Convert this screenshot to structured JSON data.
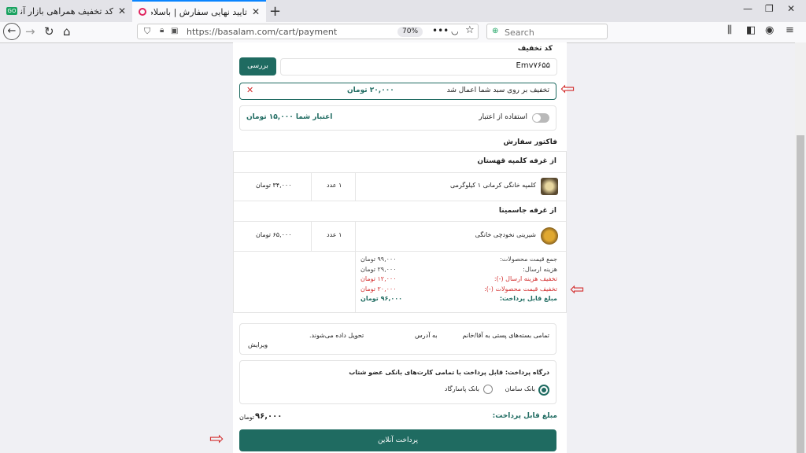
{
  "browser": {
    "tabs": [
      {
        "title": "کد تخفیف همراهی بازار آنلاین مح..."
      },
      {
        "title": "تایید نهایی سفارش | باسلام"
      }
    ],
    "url": "https://basalam.com/cart/payment",
    "zoom": "70%",
    "search_placeholder": "Search"
  },
  "discount": {
    "label": "کد تخفیف",
    "code": "Emv۷۶۵۵",
    "check_button": "بررسی",
    "applied_text": "تخفیف بر روی سبد شما اعمال شد",
    "applied_amount": "۲۰,۰۰۰ تومان"
  },
  "credit": {
    "label": "استفاده از اعتبار",
    "balance": "اعتبار شما ۱۵,۰۰۰ تومان"
  },
  "invoice": {
    "title": "فاکتور سفارش",
    "booths": [
      {
        "title": "از غرفه کلمپه قهستان",
        "product": "کلمپه خانگی کرمانی ۱ کیلوگرمی",
        "qty": "۱ عدد",
        "price": "۳۴,۰۰۰ تومان"
      },
      {
        "title": "از غرفه جاسمینا",
        "product": "شیرینی نخودچی خانگی",
        "qty": "۱ عدد",
        "price": "۶۵,۰۰۰ تومان"
      }
    ],
    "summary": [
      {
        "label": "جمع قیمت محصولات:",
        "value": "۹۹,۰۰۰ تومان",
        "color": "#444444"
      },
      {
        "label": "هزینه ارسال:",
        "value": "۲۹,۰۰۰ تومان",
        "color": "#444444"
      },
      {
        "label": "تخفیف هزینه ارسال (-):",
        "value": "۱۲,۰۰۰ تومان",
        "color": "#d32f2f"
      },
      {
        "label": "تخفیف قیمت محصولات (-):",
        "value": "۲۰,۰۰۰ تومان",
        "color": "#d32f2f"
      },
      {
        "label": "مبلغ قابل پرداخت:",
        "value": "۹۶,۰۰۰ تومان",
        "color": "#1f6b61"
      }
    ]
  },
  "delivery": {
    "text": "تمامی بسته‌های پستی به آقا/خانم",
    "address": "به آدرس",
    "delivered": "تحویل داده می‌شوند.",
    "edit": "ویرایش"
  },
  "gateway": {
    "title": "درگاه پرداخت: قابل پرداخت با تمامی کارت‌های بانکی عضو شتاب",
    "options": [
      {
        "label": "بانک سامان",
        "selected": true
      },
      {
        "label": "بانک پاسارگاد",
        "selected": false
      }
    ]
  },
  "payable": {
    "label": "مبلغ قابل پرداخت:",
    "amount": "۹۶,۰۰۰",
    "unit": "تومان"
  },
  "pay_button": "پرداخت آنلاین",
  "colors": {
    "accent": "#1f6b61",
    "annotation": "#d32f2f",
    "tab_highlight": "#0a84ff"
  }
}
